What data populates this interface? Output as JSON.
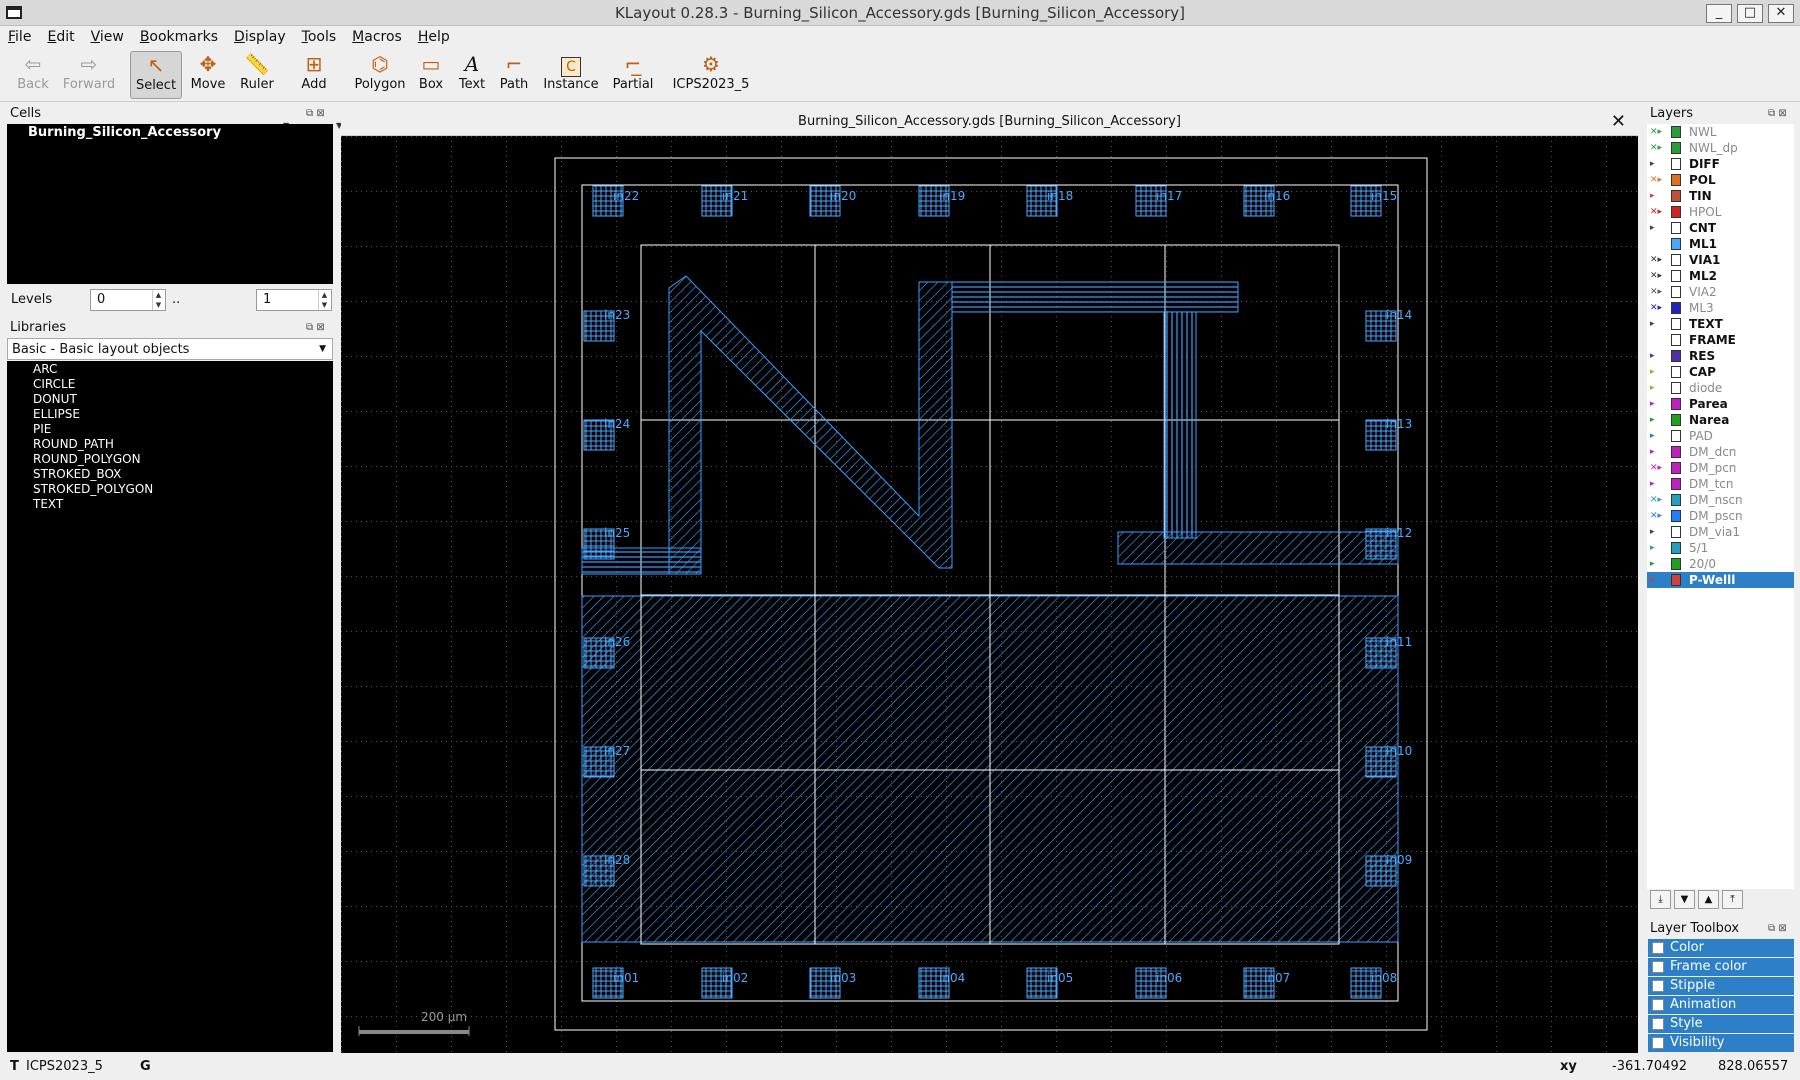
{
  "window": {
    "title": "KLayout 0.28.3 - Burning_Silicon_Accessory.gds [Burning_Silicon_Accessory]",
    "minimize": "_",
    "maximize": "□",
    "close": "✕"
  },
  "menu": [
    "File",
    "Edit",
    "View",
    "Bookmarks",
    "Display",
    "Tools",
    "Macros",
    "Help"
  ],
  "toolbar": {
    "back": "Back",
    "forward": "Forward",
    "select": "Select",
    "move": "Move",
    "ruler": "Ruler",
    "add": "Add",
    "polygon": "Polygon",
    "box": "Box",
    "text": "Text",
    "path": "Path",
    "instance": "Instance",
    "partial": "Partial",
    "macro": "ICPS2023_5"
  },
  "cells": {
    "title": "Cells",
    "items": [
      "Burning_Silicon_Accessory"
    ]
  },
  "levels": {
    "label": "Levels",
    "from": "0",
    "sep": "..",
    "to": "1"
  },
  "libraries": {
    "title": "Libraries",
    "selected": "Basic - Basic layout objects",
    "items": [
      "ARC",
      "CIRCLE",
      "DONUT",
      "ELLIPSE",
      "PIE",
      "ROUND_PATH",
      "ROUND_POLYGON",
      "STROKED_BOX",
      "STROKED_POLYGON",
      "TEXT"
    ]
  },
  "layout": {
    "tab_title": "Burning_Silicon_Accessory.gds [Burning_Silicon_Accessory]",
    "scale_label": "200  µm",
    "pads_top": [
      "in22",
      "in21",
      "in20",
      "in19",
      "in18",
      "in17",
      "in16",
      "in15"
    ],
    "pads_bottom": [
      "in01",
      "in02",
      "in03",
      "in04",
      "in05",
      "in06",
      "in07",
      "in08"
    ],
    "pads_left": [
      "in23",
      "in24",
      "in25",
      "in26",
      "in27",
      "in28"
    ],
    "pads_right": [
      "in14",
      "in13",
      "in12",
      "in11",
      "in10",
      "in09"
    ]
  },
  "layers": {
    "title": "Layers",
    "items": [
      {
        "name": "NWL",
        "visible": false,
        "mark": "✕▸",
        "markColor": "#2a9d3a",
        "swatch": "#2a9d3a"
      },
      {
        "name": "NWL_dp",
        "visible": false,
        "mark": "✕▸",
        "markColor": "#2a9d3a",
        "swatch": "#2a9d3a"
      },
      {
        "name": "DIFF",
        "visible": true,
        "mark": "▸",
        "markColor": "#444",
        "swatch": "#ffffff"
      },
      {
        "name": "POL",
        "visible": true,
        "mark": "✕▸",
        "markColor": "#e07020",
        "swatch": "#e07020"
      },
      {
        "name": "TIN",
        "visible": true,
        "mark": "▸",
        "markColor": "#c0503a",
        "swatch": "#c0503a"
      },
      {
        "name": "HPOL",
        "visible": false,
        "mark": "✕▸",
        "markColor": "#d02020",
        "swatch": "#d02020"
      },
      {
        "name": "CNT",
        "visible": true,
        "mark": "▸",
        "markColor": "#444",
        "swatch": "#ffffff"
      },
      {
        "name": "ML1",
        "visible": true,
        "mark": "",
        "markColor": "#2d7fc8",
        "swatch": "#4aa8ff"
      },
      {
        "name": "VIA1",
        "visible": true,
        "mark": "✕▸",
        "markColor": "#333",
        "swatch": "#ffffff"
      },
      {
        "name": "ML2",
        "visible": true,
        "mark": "✕▸",
        "markColor": "#333",
        "swatch": "#ffffff"
      },
      {
        "name": "VIA2",
        "visible": false,
        "mark": "✕▸",
        "markColor": "#555",
        "swatch": "#ffffff"
      },
      {
        "name": "ML3",
        "visible": false,
        "mark": "✕▸",
        "markColor": "#2020c0",
        "swatch": "#2020c0"
      },
      {
        "name": "TEXT",
        "visible": true,
        "mark": "▸",
        "markColor": "#444",
        "swatch": "#ffffff"
      },
      {
        "name": "FRAME",
        "visible": true,
        "mark": "",
        "markColor": "#444",
        "swatch": "#ffffff"
      },
      {
        "name": "RES",
        "visible": true,
        "mark": "▸",
        "markColor": "#5030a0",
        "swatch": "#5030a0"
      },
      {
        "name": "CAP",
        "visible": true,
        "mark": "▸",
        "markColor": "#c0a020",
        "swatch": "#ffffff"
      },
      {
        "name": "diode",
        "visible": false,
        "mark": "▸",
        "markColor": "#c0a020",
        "swatch": "#ffffff"
      },
      {
        "name": "Parea",
        "visible": true,
        "mark": "▸",
        "markColor": "#c020c0",
        "swatch": "#c020c0"
      },
      {
        "name": "Narea",
        "visible": true,
        "mark": "▸",
        "markColor": "#20a020",
        "swatch": "#20a020"
      },
      {
        "name": "PAD",
        "visible": false,
        "mark": "▸",
        "markColor": "#2080c0",
        "swatch": "#ffffff"
      },
      {
        "name": "DM_dcn",
        "visible": false,
        "mark": "▸",
        "markColor": "#c020c0",
        "swatch": "#c020c0"
      },
      {
        "name": "DM_pcn",
        "visible": false,
        "mark": "✕▸",
        "markColor": "#c020c0",
        "swatch": "#c020c0"
      },
      {
        "name": "DM_tcn",
        "visible": false,
        "mark": "▸",
        "markColor": "#c020c0",
        "swatch": "#c020c0"
      },
      {
        "name": "DM_nscn",
        "visible": false,
        "mark": "✕▸",
        "markColor": "#20a0c0",
        "swatch": "#20a0c0"
      },
      {
        "name": "DM_pscn",
        "visible": false,
        "mark": "✕▸",
        "markColor": "#2080ff",
        "swatch": "#2080ff"
      },
      {
        "name": "DM_via1",
        "visible": false,
        "mark": "▸",
        "markColor": "#444",
        "swatch": "#ffffff"
      },
      {
        "name": "5/1",
        "visible": false,
        "mark": "▸",
        "markColor": "#20a0c0",
        "swatch": "#20a0c0"
      },
      {
        "name": "20/0",
        "visible": false,
        "mark": "▸",
        "markColor": "#20a020",
        "swatch": "#20a020"
      },
      {
        "name": "P-Welll",
        "visible": true,
        "mark": "▸",
        "markColor": "#d04040",
        "swatch": "#d04040",
        "selected": true
      }
    ]
  },
  "toolbox": {
    "title": "Layer Toolbox",
    "items": [
      "Color",
      "Frame color",
      "Stipple",
      "Animation",
      "Style",
      "Visibility"
    ]
  },
  "status": {
    "macro_label": "ICPS2023_5",
    "mode": "G",
    "coord_label": "xy",
    "x": "-361.70492",
    "y": "828.06557"
  },
  "colors": {
    "metal": "#3aa0ff",
    "pad": "#4aa8ff",
    "frame": "#ffffff",
    "grid": "#555555"
  }
}
